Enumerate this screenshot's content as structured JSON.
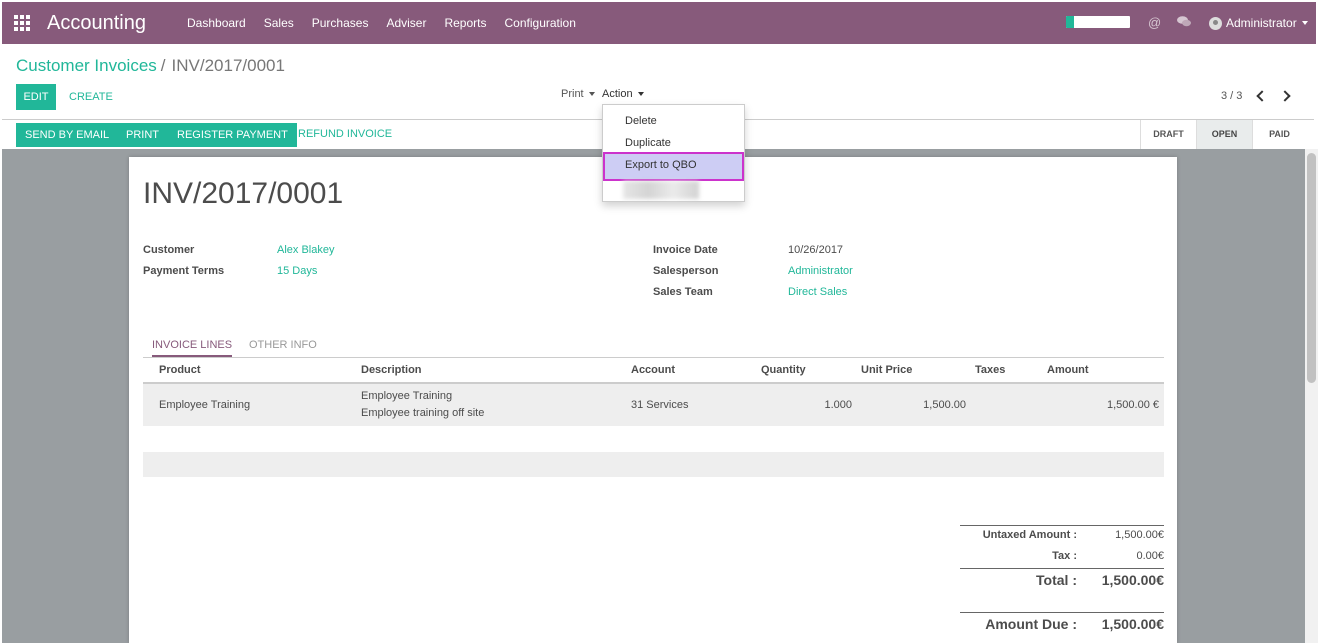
{
  "app": {
    "title": "Accounting",
    "menu": [
      "Dashboard",
      "Sales",
      "Purchases",
      "Adviser",
      "Reports",
      "Configuration"
    ],
    "user": "Administrator",
    "progress_fraction": 0.12,
    "colors": {
      "brand": "#875a7b",
      "accent": "#21b799"
    }
  },
  "breadcrumb": {
    "parent": "Customer Invoices",
    "separator": "/",
    "current": "INV/2017/0001"
  },
  "control": {
    "edit": "EDIT",
    "create": "CREATE",
    "print": "Print",
    "action": "Action",
    "pager": "3 / 3"
  },
  "action_menu": {
    "items": [
      "Delete",
      "Duplicate",
      "Export to QBO"
    ],
    "highlighted": "Export to QBO"
  },
  "statusbar": {
    "buttons": [
      "SEND BY EMAIL",
      "PRINT",
      "REGISTER PAYMENT"
    ],
    "refund": "REFUND INVOICE",
    "stages": [
      "DRAFT",
      "OPEN",
      "PAID"
    ],
    "active_stage": "OPEN"
  },
  "invoice": {
    "number": "INV/2017/0001",
    "left": [
      {
        "label": "Customer",
        "value": "Alex Blakey"
      },
      {
        "label": "Payment Terms",
        "value": "15 Days"
      }
    ],
    "right": [
      {
        "label": "Invoice Date",
        "value": "10/26/2017"
      },
      {
        "label": "Salesperson",
        "value": "Administrator"
      },
      {
        "label": "Sales Team",
        "value": "Direct Sales"
      }
    ],
    "tabs": [
      "INVOICE LINES",
      "OTHER INFO"
    ],
    "columns": [
      "Product",
      "Description",
      "Account",
      "Quantity",
      "Unit Price",
      "Taxes",
      "Amount"
    ],
    "lines": [
      {
        "product": "Employee Training",
        "description_1": "Employee Training",
        "description_2": "Employee training off site",
        "account": "31 Services",
        "quantity": "1.000",
        "unit_price": "1,500.00",
        "taxes": "",
        "amount": "1,500.00 €"
      }
    ],
    "totals": {
      "untaxed_label": "Untaxed Amount :",
      "untaxed_value": "1,500.00€",
      "tax_label": "Tax :",
      "tax_value": "0.00€",
      "total_label": "Total :",
      "total_value": "1,500.00€",
      "due_label": "Amount Due :",
      "due_value": "1,500.00€"
    }
  }
}
